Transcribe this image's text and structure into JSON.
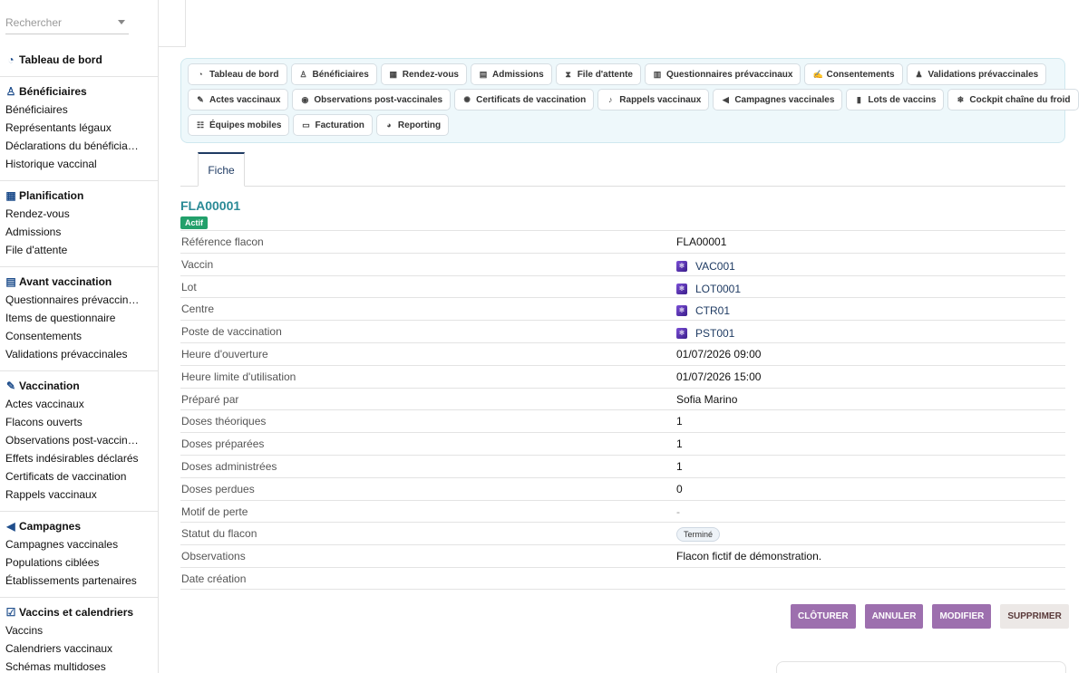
{
  "search": {
    "placeholder": "Rechercher"
  },
  "sidebar": {
    "sections": [
      {
        "title": "Tableau de bord",
        "icon": "gauge-icon",
        "items": []
      },
      {
        "title": "Bénéficiaires",
        "icon": "people-icon",
        "items": [
          "Bénéficiaires",
          "Représentants légaux",
          "Déclarations du bénéficia…",
          "Historique vaccinal"
        ]
      },
      {
        "title": "Planification",
        "icon": "calendar-icon",
        "items": [
          "Rendez-vous",
          "Admissions",
          "File d'attente"
        ]
      },
      {
        "title": "Avant vaccination",
        "icon": "clipboard-icon",
        "items": [
          "Questionnaires prévaccin…",
          "Items de questionnaire",
          "Consentements",
          "Validations prévaccinales"
        ]
      },
      {
        "title": "Vaccination",
        "icon": "syringe-icon",
        "items": [
          "Actes vaccinaux",
          "Flacons ouverts",
          "Observations post-vaccin…",
          "Effets indésirables déclarés",
          "Certificats de vaccination",
          "Rappels vaccinaux"
        ]
      },
      {
        "title": "Campagnes",
        "icon": "megaphone-icon",
        "items": [
          "Campagnes vaccinales",
          "Populations ciblées",
          "Établissements partenaires"
        ]
      },
      {
        "title": "Vaccins et calendriers",
        "icon": "calendar-check-icon",
        "items": [
          "Vaccins",
          "Calendriers vaccinaux",
          "Schémas multidoses"
        ]
      }
    ]
  },
  "menu": {
    "rows": [
      [
        {
          "label": "Tableau de bord",
          "icon": "gauge-icon"
        },
        {
          "label": "Bénéficiaires",
          "icon": "people-icon"
        },
        {
          "label": "Rendez-vous",
          "icon": "calendar-icon"
        },
        {
          "label": "Admissions",
          "icon": "clipboard-icon"
        },
        {
          "label": "File d'attente",
          "icon": "hourglass-icon"
        },
        {
          "label": "Questionnaires prévaccinaux",
          "icon": "list-icon"
        },
        {
          "label": "Consentements",
          "icon": "signature-icon"
        },
        {
          "label": "Validations prévaccinales",
          "icon": "user-check-icon"
        }
      ],
      [
        {
          "label": "Actes vaccinaux",
          "icon": "syringe-icon"
        },
        {
          "label": "Observations post-vaccinales",
          "icon": "eye-icon"
        },
        {
          "label": "Certificats de vaccination",
          "icon": "certificate-icon"
        },
        {
          "label": "Rappels vaccinaux",
          "icon": "bell-icon"
        },
        {
          "label": "Campagnes vaccinales",
          "icon": "megaphone-icon"
        },
        {
          "label": "Lots de vaccins",
          "icon": "barcode-icon"
        },
        {
          "label": "Cockpit chaîne du froid",
          "icon": "snowflake-icon"
        }
      ],
      [
        {
          "label": "Équipes mobiles",
          "icon": "team-icon"
        },
        {
          "label": "Facturation",
          "icon": "invoice-icon"
        },
        {
          "label": "Reporting",
          "icon": "pie-icon"
        }
      ]
    ]
  },
  "tab": {
    "label": "Fiche"
  },
  "record": {
    "title": "FLA00001",
    "status_badge": "Actif",
    "fields": [
      {
        "label": "Référence flacon",
        "value": "FLA00001",
        "type": "text"
      },
      {
        "label": "Vaccin",
        "value": "VAC001",
        "type": "link"
      },
      {
        "label": "Lot",
        "value": "LOT0001",
        "type": "link"
      },
      {
        "label": "Centre",
        "value": "CTR01",
        "type": "link"
      },
      {
        "label": "Poste de vaccination",
        "value": "PST001",
        "type": "link"
      },
      {
        "label": "Heure d'ouverture",
        "value": "01/07/2026 09:00",
        "type": "text"
      },
      {
        "label": "Heure limite d'utilisation",
        "value": "01/07/2026 15:00",
        "type": "text"
      },
      {
        "label": "Préparé par",
        "value": "Sofia Marino",
        "type": "text"
      },
      {
        "label": "Doses théoriques",
        "value": "1",
        "type": "text"
      },
      {
        "label": "Doses préparées",
        "value": "1",
        "type": "text"
      },
      {
        "label": "Doses administrées",
        "value": "1",
        "type": "text"
      },
      {
        "label": "Doses perdues",
        "value": "0",
        "type": "text"
      },
      {
        "label": "Motif de perte",
        "value": "-",
        "type": "dash"
      },
      {
        "label": "Statut du flacon",
        "value": "Terminé",
        "type": "pill"
      },
      {
        "label": "Observations",
        "value": "Flacon fictif de démonstration.",
        "type": "text"
      },
      {
        "label": "Date création",
        "value": "",
        "type": "text"
      }
    ]
  },
  "actions": {
    "close_label": "CLÔTURER",
    "cancel_label": "ANNULER",
    "edit_label": "MODIFIER",
    "delete_label": "SUPPRIMER"
  },
  "colors": {
    "accent": "#2a8a96",
    "badge": "#22a06b",
    "action": "#9d6fae",
    "menu_bg": "#eef8fb"
  }
}
